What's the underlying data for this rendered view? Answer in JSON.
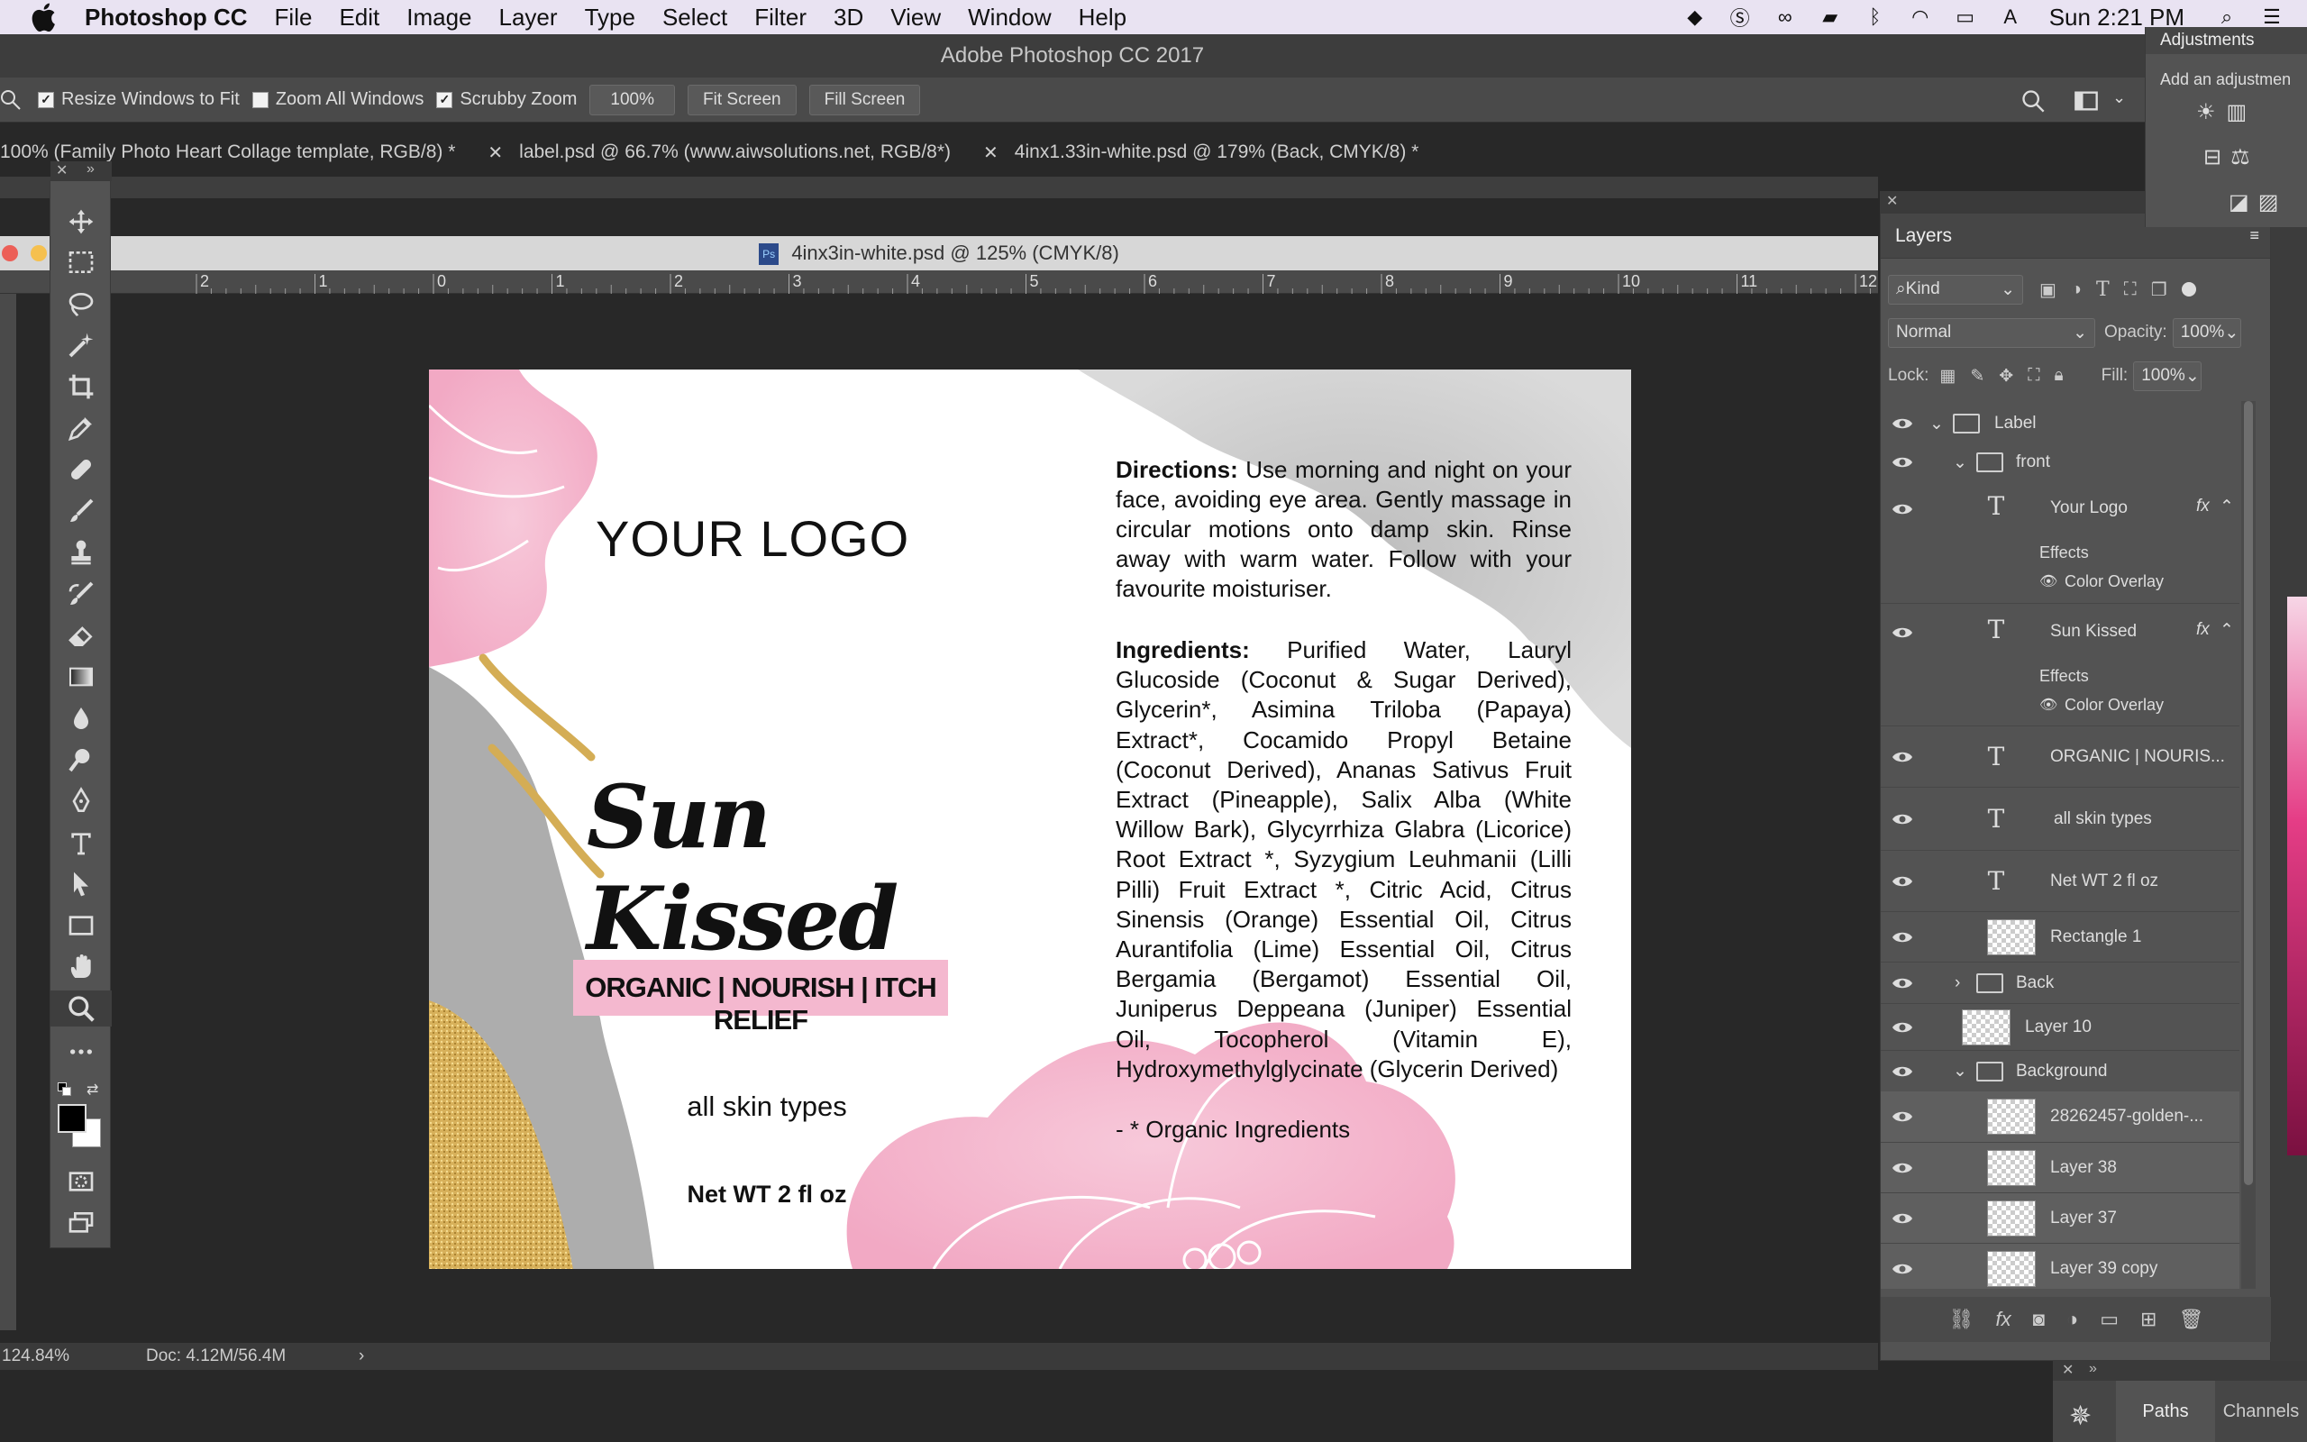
{
  "menubar": {
    "app_name": "Photoshop CC",
    "items": [
      "File",
      "Edit",
      "Image",
      "Layer",
      "Type",
      "Select",
      "Filter",
      "3D",
      "View",
      "Window",
      "Help"
    ],
    "clock": "Sun 2:21 PM"
  },
  "window_title": "Adobe Photoshop CC 2017",
  "options": {
    "resize_windows": "Resize Windows to Fit",
    "zoom_all": "Zoom All Windows",
    "scrubby_zoom": "Scrubby Zoom",
    "zoom_value": "100%",
    "fit_screen": "Fit Screen",
    "fill_screen": "Fill Screen"
  },
  "doc_tabs": [
    {
      "label": "100% (Family Photo Heart Collage template, RGB/8) *"
    },
    {
      "label": "label.psd @ 66.7% (www.aiwsolutions.net, RGB/8*)"
    },
    {
      "label": "4inx1.33in-white.psd @ 179% (Back, CMYK/8) *"
    }
  ],
  "document": {
    "title": "4inx3in-white.psd @ 125% (CMYK/8)",
    "ruler_labels": [
      "2",
      "1",
      "0",
      "1",
      "2",
      "3",
      "4",
      "5",
      "6",
      "7",
      "8",
      "9",
      "10",
      "11",
      "12"
    ]
  },
  "label": {
    "logo": "YOUR LOGO",
    "product_name": "Sun Kissed",
    "tagline": "ORGANIC | NOURISH | ITCH RELIEF",
    "skin_types": "all skin types",
    "net_wt": "Net WT 2 fl oz",
    "directions_heading": "Directions:",
    "directions_text": "Use morning and night on your face, avoiding eye area. Gently massage in circular motions onto damp skin. Rinse away with warm water. Follow with your favourite moisturiser.",
    "ingredients_heading": "Ingredients:",
    "ingredients_text": "Purified Water, Lauryl Glucoside (Coconut & Sugar Derived), Glycerin*, Asimina Triloba (Papaya) Extract*, Cocamido Propyl Betaine (Coconut Derived), Ananas Sativus Fruit Extract (Pineapple), Salix Alba (White Willow Bark), Glycyrrhiza Glabra (Licorice) Root Extract *, Syzygium Leuhmanii (Lilli Pilli) Fruit Extract *, Citric Acid, Citrus Sinensis (Orange) Essential Oil, Citrus Aurantifolia (Lime) Essential Oil, Citrus Bergamia (Bergamot) Essential Oil, Juniperus Deppeana (Juniper) Essential Oil, Tocopherol (Vitamin E), Hydroxymethylglycinate (Glycerin Derived)",
    "organic_note": "- * Organic Ingredients"
  },
  "status": {
    "zoom": "124.84%",
    "doc_size": "Doc: 4.12M/56.4M"
  },
  "layers_panel": {
    "title": "Layers",
    "filter": "Kind",
    "blend_mode": "Normal",
    "opacity_label": "Opacity:",
    "opacity": "100%",
    "lock_label": "Lock:",
    "fill_label": "Fill:",
    "fill": "100%",
    "layers": [
      {
        "name": "Label"
      },
      {
        "name": "front"
      },
      {
        "name": "Your Logo"
      },
      {
        "name": "Effects"
      },
      {
        "name": "Color Overlay"
      },
      {
        "name": "Sun Kissed"
      },
      {
        "name": "Effects"
      },
      {
        "name": "Color Overlay"
      },
      {
        "name": "ORGANIC | NOURIS..."
      },
      {
        "name": "all skin types"
      },
      {
        "name": "Net WT 2 fl oz"
      },
      {
        "name": "Rectangle 1"
      },
      {
        "name": "Back"
      },
      {
        "name": "Layer 10"
      },
      {
        "name": "Background"
      },
      {
        "name": "28262457-golden-..."
      },
      {
        "name": "Layer 38"
      },
      {
        "name": "Layer 37"
      },
      {
        "name": "Layer 39 copy"
      }
    ],
    "fx": "fx"
  },
  "adjustments": {
    "title": "Adjustments",
    "subtitle": "Add an adjustmen"
  },
  "bottom_panel": {
    "paths": "Paths",
    "channels": "Channels"
  },
  "colors": {
    "pink": "#f4b8cf",
    "gold": "#c9a24a",
    "panel": "#535353"
  }
}
